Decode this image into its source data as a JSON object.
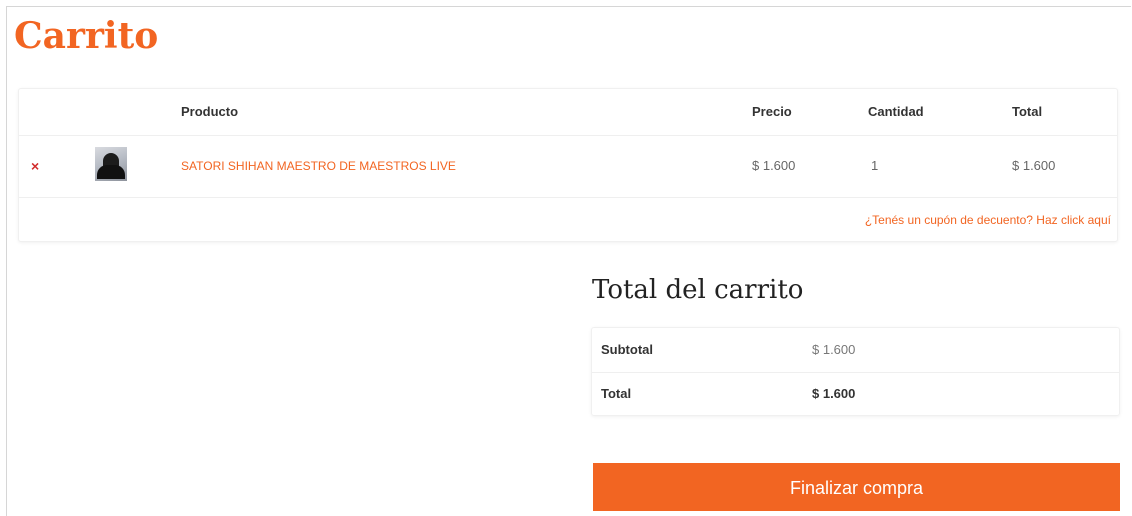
{
  "page": {
    "title": "Carrito"
  },
  "cart_table": {
    "headers": {
      "product": "Producto",
      "price": "Precio",
      "quantity": "Cantidad",
      "total": "Total"
    },
    "items": [
      {
        "remove_icon": "×",
        "name": "SATORI SHIHAN MAESTRO DE MAESTROS LIVE",
        "price": "$ 1.600",
        "quantity": "1",
        "total": "$ 1.600"
      }
    ],
    "coupon_link": "¿Tenés un cupón de decuento? Haz click aquí"
  },
  "totals": {
    "title": "Total del carrito",
    "subtotal_label": "Subtotal",
    "subtotal_value": "$ 1.600",
    "total_label": "Total",
    "total_value": "$ 1.600"
  },
  "checkout": {
    "label": "Finalizar compra"
  },
  "colors": {
    "accent": "#f26522",
    "remove": "#d12b2b"
  },
  "icons": {
    "remove": "close-icon",
    "thumbnail": "product-thumbnail"
  }
}
